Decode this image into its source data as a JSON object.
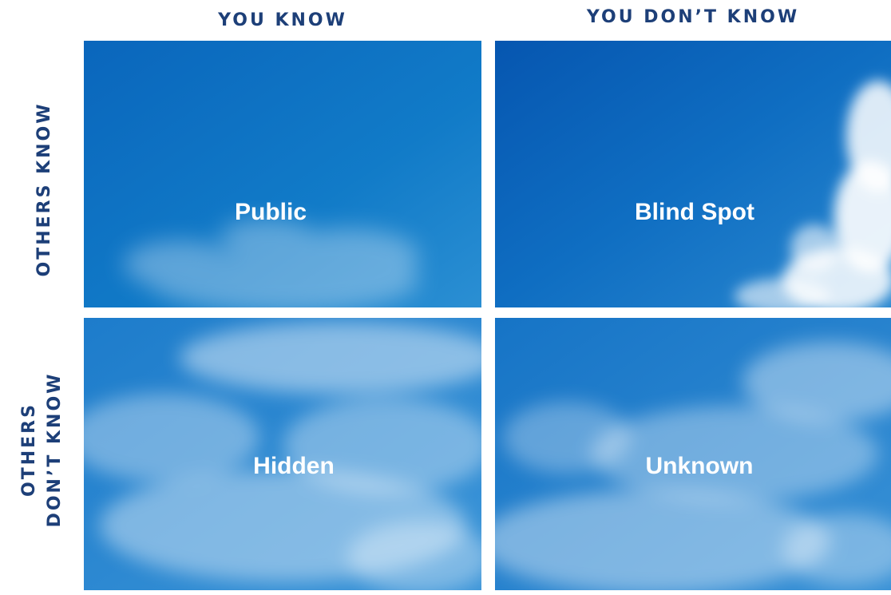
{
  "columns": {
    "left": "YOU KNOW",
    "right": "YOU DON’T KNOW"
  },
  "rows": {
    "top": "OTHERS KNOW",
    "bottom_line1": "OTHERS",
    "bottom_line2": "DON’T KNOW"
  },
  "quadrants": {
    "top_left": "Public",
    "top_right": "Blind Spot",
    "bottom_left": "Hidden",
    "bottom_right": "Unknown"
  },
  "colors": {
    "header_text": "#1d3f78",
    "sky_deep": "#0a62b8",
    "sky_mid": "#1f7fcc",
    "sky_light": "#5aa8e0",
    "cloud": "#ffffff"
  }
}
